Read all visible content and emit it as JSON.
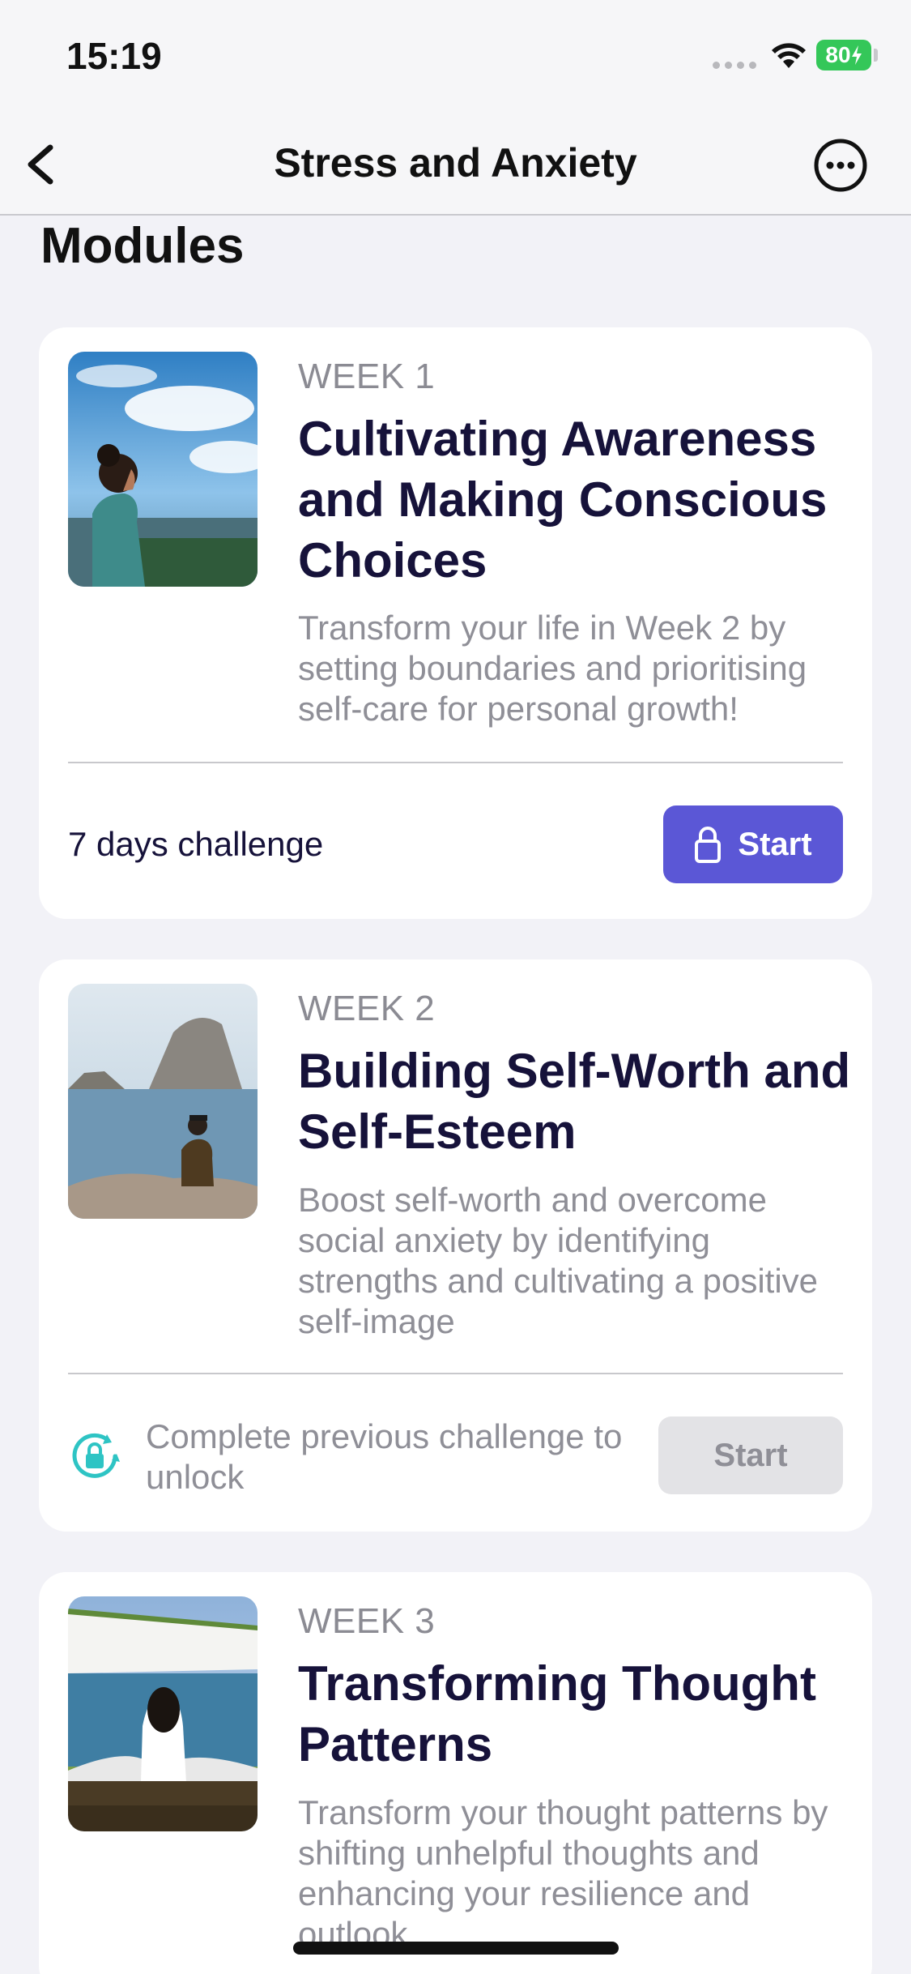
{
  "status_bar": {
    "time": "15:19",
    "battery": "80"
  },
  "nav": {
    "title": "Stress and Anxiety",
    "back_icon": "chevron-left-icon",
    "more_icon": "ellipsis-circle-icon"
  },
  "section_title": "Modules",
  "modules": [
    {
      "week": "WEEK 1",
      "title": "Cultivating Awareness and Making Conscious Choices",
      "description": "Transform your life in Week 2 by setting boundaries and prioritising self-care for personal growth!",
      "footer_text": "7 days challenge",
      "button_label": "Start",
      "state": "available"
    },
    {
      "week": "WEEK 2",
      "title": "Building Self-Worth and Self-Esteem",
      "description": "Boost self-worth and overcome social anxiety by identifying strengths and cultivating a positive self-image",
      "footer_text": "Complete previous challenge to unlock",
      "button_label": "Start",
      "state": "locked"
    },
    {
      "week": "WEEK 3",
      "title": "Transforming Thought Patterns",
      "description": "Transform your thought patterns by shifting unhelpful thoughts and enhancing your resilience and outlook",
      "state": "locked"
    }
  ],
  "colors": {
    "accent": "#5b57d6",
    "title": "#16123a",
    "muted": "#8f8f97",
    "lock_cycle": "#2ec4c4",
    "background": "#f2f2f7"
  }
}
